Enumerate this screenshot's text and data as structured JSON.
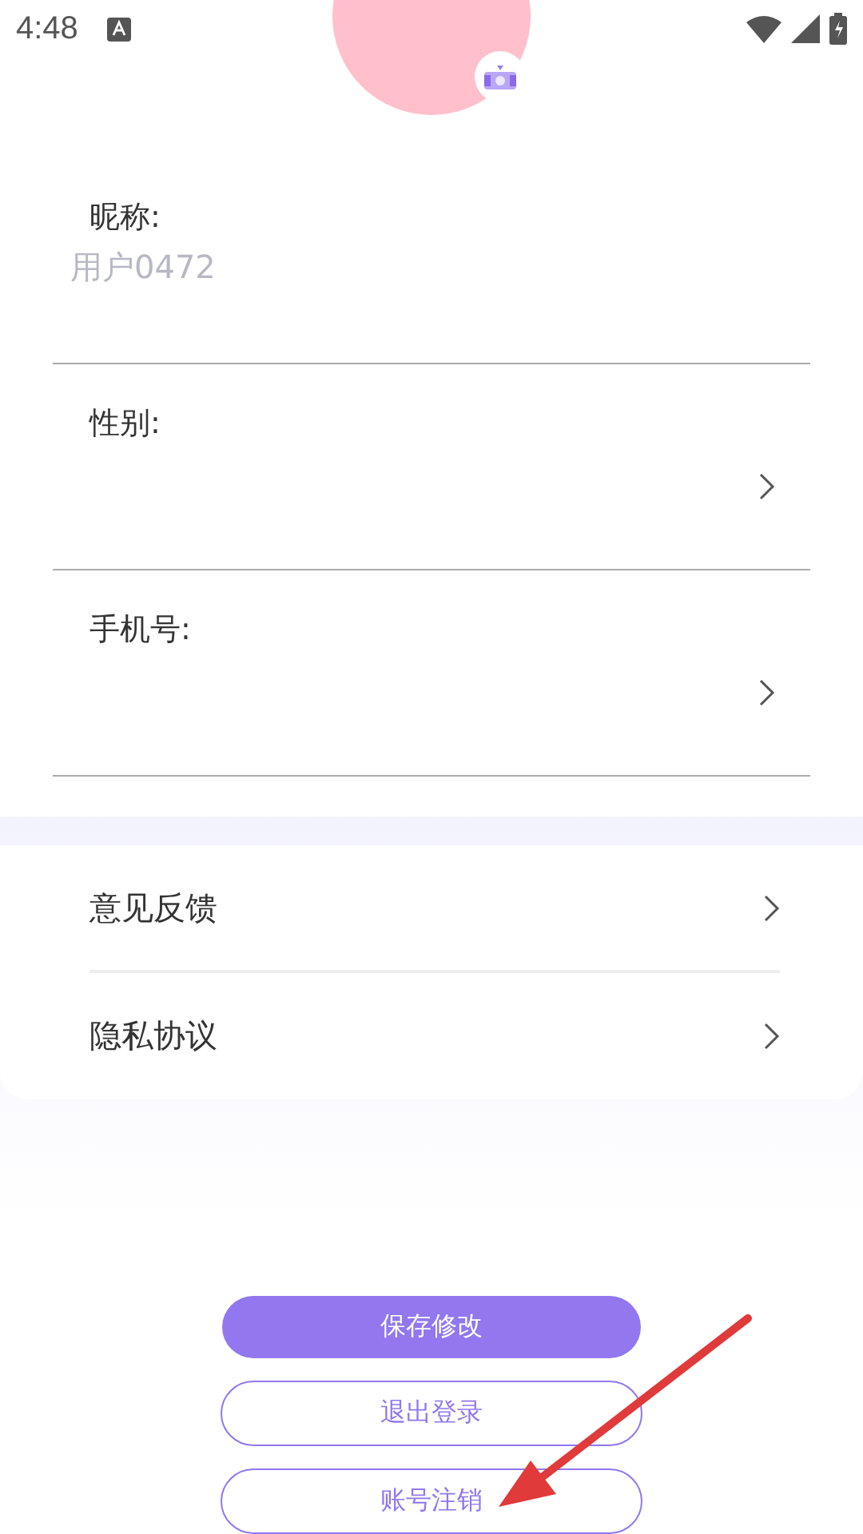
{
  "status_bar": {
    "time": "4:48"
  },
  "profile_fields": [
    {
      "kind": "input",
      "label": "昵称:",
      "placeholder": "用户0472"
    },
    {
      "kind": "select",
      "label": "性别:"
    },
    {
      "kind": "select",
      "label": "手机号:"
    }
  ],
  "menu_items": [
    {
      "label": "意见反馈"
    },
    {
      "label": "隐私协议"
    }
  ],
  "buttons": [
    {
      "kind": "primary",
      "label": "保存修改"
    },
    {
      "kind": "outline",
      "label": "退出登录"
    },
    {
      "kind": "outline",
      "label": "账号注销"
    }
  ]
}
